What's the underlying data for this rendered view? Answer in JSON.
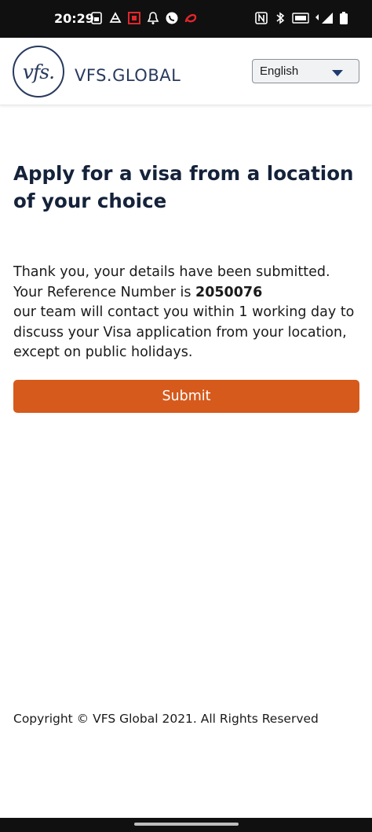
{
  "status_bar": {
    "time": "20:29",
    "left_icons": [
      "sim-card-icon",
      "payment-app-icon",
      "bank-app-icon",
      "notification-bell-icon",
      "whatsapp-icon",
      "airtel-icon"
    ],
    "right_icons": [
      "nfc-icon",
      "bluetooth-icon",
      "volte-icon",
      "signal-4g-icon",
      "battery-icon"
    ]
  },
  "header": {
    "logo_mark": "vfs.",
    "logo_text": "VFS.GLOBAL",
    "language": "English"
  },
  "main": {
    "title": "Apply for a visa from a location of your choice",
    "message_part1": "Thank you, your details have been submitted. Your Reference Number is ",
    "reference_number": "2050076",
    "message_part2": "our team will contact you within 1 working day to discuss your Visa application from your location, except on public holidays.",
    "submit_label": "Submit"
  },
  "footer": {
    "copyright": "Copyright © VFS Global 2021. All Rights Reserved"
  },
  "colors": {
    "brand_navy": "#283a5e",
    "accent_orange": "#d65a1c"
  }
}
